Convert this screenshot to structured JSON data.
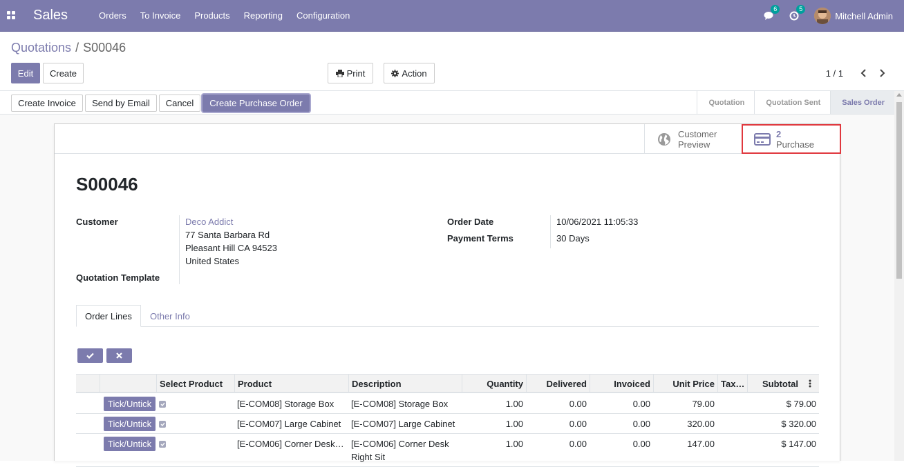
{
  "navbar": {
    "app_name": "Sales",
    "menu": [
      "Orders",
      "To Invoice",
      "Products",
      "Reporting",
      "Configuration"
    ],
    "messages_count": "6",
    "activities_count": "5",
    "user_name": "Mitchell Admin"
  },
  "breadcrumb": {
    "parent": "Quotations",
    "separator": "/",
    "current": "S00046"
  },
  "control": {
    "edit_label": "Edit",
    "create_label": "Create",
    "print_label": "Print",
    "action_label": "Action",
    "pager": "1 / 1"
  },
  "statusbar": {
    "buttons": [
      "Create Invoice",
      "Send by Email",
      "Cancel",
      "Create Purchase Order"
    ],
    "stages": [
      "Quotation",
      "Quotation Sent",
      "Sales Order"
    ],
    "active_stage": "Sales Order"
  },
  "smart_buttons": {
    "customer_preview_line1": "Customer",
    "customer_preview_line2": "Preview",
    "purchase_count": "2",
    "purchase_label": "Purchase"
  },
  "form": {
    "title": "S00046",
    "customer_label": "Customer",
    "customer_name": "Deco Addict",
    "address_line1": "77 Santa Barbara Rd",
    "address_line2": "Pleasant Hill CA 94523",
    "address_line3": "United States",
    "template_label": "Quotation Template",
    "order_date_label": "Order Date",
    "order_date": "10/06/2021 11:05:33",
    "payment_terms_label": "Payment Terms",
    "payment_terms": "30 Days"
  },
  "tabs": [
    "Order Lines",
    "Other Info"
  ],
  "table": {
    "headers": [
      "Select Product",
      "Product",
      "Description",
      "Quantity",
      "Delivered",
      "Invoiced",
      "Unit Price",
      "Tax…",
      "Subtotal"
    ],
    "tick_label": "Tick/Untick",
    "rows": [
      {
        "product": "[E-COM08] Storage Box",
        "description": "[E-COM08] Storage Box",
        "description2": "",
        "quantity": "1.00",
        "delivered": "0.00",
        "invoiced": "0.00",
        "unit_price": "79.00",
        "subtotal": "$ 79.00"
      },
      {
        "product": "[E-COM07] Large Cabinet",
        "description": "[E-COM07] Large Cabinet",
        "description2": "",
        "quantity": "1.00",
        "delivered": "0.00",
        "invoiced": "0.00",
        "unit_price": "320.00",
        "subtotal": "$ 320.00"
      },
      {
        "product": "[E-COM06] Corner Desk…",
        "description": "[E-COM06] Corner Desk",
        "description2": "Right Sit",
        "quantity": "1.00",
        "delivered": "0.00",
        "invoiced": "0.00",
        "unit_price": "147.00",
        "subtotal": "$ 147.00"
      }
    ]
  },
  "colors": {
    "brand": "#7c7bad",
    "badge": "#00a09d",
    "highlight_border": "#e0383e"
  }
}
